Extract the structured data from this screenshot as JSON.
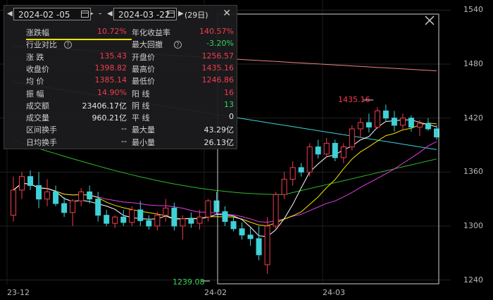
{
  "range_panel": {
    "start_date": "2024-02 -05",
    "end_date": "2024-03 -22",
    "separator": "-",
    "days": "(29日)",
    "rows": [
      {
        "l1": "涨跌幅",
        "v1": "10.72%",
        "l2": "年化收益率",
        "v2": "140.57%"
      },
      {
        "l1": "行业对比",
        "v1": "",
        "l2": "最大回撤",
        "v2": "-3.20%"
      },
      {
        "l1": "涨  跌",
        "v1": "135.43",
        "l2": "开盘价",
        "v2": "1256.57"
      },
      {
        "l1": "收盘价",
        "v1": "1398.82",
        "l2": "最高价",
        "v2": "1435.16"
      },
      {
        "l1": "均  价",
        "v1": "1385.14",
        "l2": "最低价",
        "v2": "1246.86"
      },
      {
        "l1": "振  幅",
        "v1": "14.90%",
        "l2": "阳  线",
        "v2": "16"
      },
      {
        "l1": "成交额",
        "v1": "23406.17亿",
        "l2": "阴  线",
        "v2": "13"
      },
      {
        "l1": "成交量",
        "v1": "960.21亿",
        "l2": "平  线",
        "v2": "0"
      },
      {
        "l1": "区间换手",
        "v1": "--",
        "l2": "最大量",
        "v2": "43.29亿"
      },
      {
        "l1": "日均换手",
        "v1": "--",
        "l2": "最小量",
        "v2": "26.13亿"
      }
    ]
  },
  "axis": {
    "y_ticks": [
      "1540",
      "1480",
      "1420",
      "1360",
      "1300",
      "1240"
    ],
    "x_ticks": [
      "23-12",
      "24-02",
      "24-03"
    ]
  },
  "annotations": {
    "high_label": "1435.16",
    "low_label": "1239.08"
  },
  "colors": {
    "up": "#f23d4f",
    "down": "#3fd1d7",
    "ma5": "#ffffff",
    "ma10": "#f0e300",
    "ma20": "#e23ce8",
    "ma60": "#2eb82e",
    "ma_long": "#3fd1d7",
    "ma_vlong": "#f08080"
  },
  "chart_data": {
    "type": "candlestick",
    "y_range": [
      1235,
      1545
    ],
    "candles": [
      [
        1312,
        1355,
        1305,
        1340
      ],
      [
        1340,
        1360,
        1330,
        1355
      ],
      [
        1355,
        1362,
        1340,
        1345
      ],
      [
        1345,
        1360,
        1320,
        1330
      ],
      [
        1330,
        1352,
        1322,
        1338
      ],
      [
        1338,
        1345,
        1322,
        1325
      ],
      [
        1325,
        1332,
        1310,
        1315
      ],
      [
        1315,
        1330,
        1300,
        1328
      ],
      [
        1328,
        1342,
        1322,
        1338
      ],
      [
        1338,
        1345,
        1325,
        1330
      ],
      [
        1330,
        1338,
        1305,
        1312
      ],
      [
        1312,
        1318,
        1300,
        1303
      ],
      [
        1303,
        1312,
        1298,
        1310
      ],
      [
        1310,
        1318,
        1300,
        1304
      ],
      [
        1304,
        1322,
        1300,
        1318
      ],
      [
        1318,
        1328,
        1300,
        1306
      ],
      [
        1306,
        1312,
        1296,
        1300
      ],
      [
        1300,
        1316,
        1295,
        1312
      ],
      [
        1312,
        1330,
        1305,
        1320
      ],
      [
        1320,
        1326,
        1295,
        1300
      ],
      [
        1300,
        1312,
        1285,
        1308
      ],
      [
        1308,
        1315,
        1298,
        1303
      ],
      [
        1303,
        1318,
        1296,
        1310
      ],
      [
        1310,
        1330,
        1305,
        1328
      ],
      [
        1328,
        1338,
        1312,
        1316
      ],
      [
        1316,
        1322,
        1300,
        1305
      ],
      [
        1305,
        1312,
        1294,
        1297
      ],
      [
        1297,
        1304,
        1285,
        1290
      ],
      [
        1290,
        1298,
        1278,
        1286
      ],
      [
        1286,
        1300,
        1262,
        1268
      ],
      [
        1257,
        1310,
        1247,
        1300
      ],
      [
        1300,
        1338,
        1296,
        1335
      ],
      [
        1335,
        1360,
        1330,
        1352
      ],
      [
        1352,
        1372,
        1345,
        1365
      ],
      [
        1365,
        1370,
        1355,
        1360
      ],
      [
        1360,
        1392,
        1355,
        1388
      ],
      [
        1388,
        1396,
        1375,
        1380
      ],
      [
        1380,
        1398,
        1376,
        1392
      ],
      [
        1392,
        1396,
        1372,
        1376
      ],
      [
        1376,
        1392,
        1370,
        1388
      ],
      [
        1388,
        1412,
        1384,
        1408
      ],
      [
        1408,
        1420,
        1398,
        1415
      ],
      [
        1415,
        1425,
        1404,
        1410
      ],
      [
        1410,
        1432,
        1408,
        1428
      ],
      [
        1428,
        1435,
        1416,
        1420
      ],
      [
        1420,
        1428,
        1405,
        1412
      ],
      [
        1412,
        1425,
        1406,
        1420
      ],
      [
        1420,
        1423,
        1405,
        1410
      ],
      [
        1410,
        1418,
        1400,
        1414
      ],
      [
        1414,
        1420,
        1406,
        1408
      ],
      [
        1408,
        1412,
        1396,
        1399
      ]
    ]
  }
}
